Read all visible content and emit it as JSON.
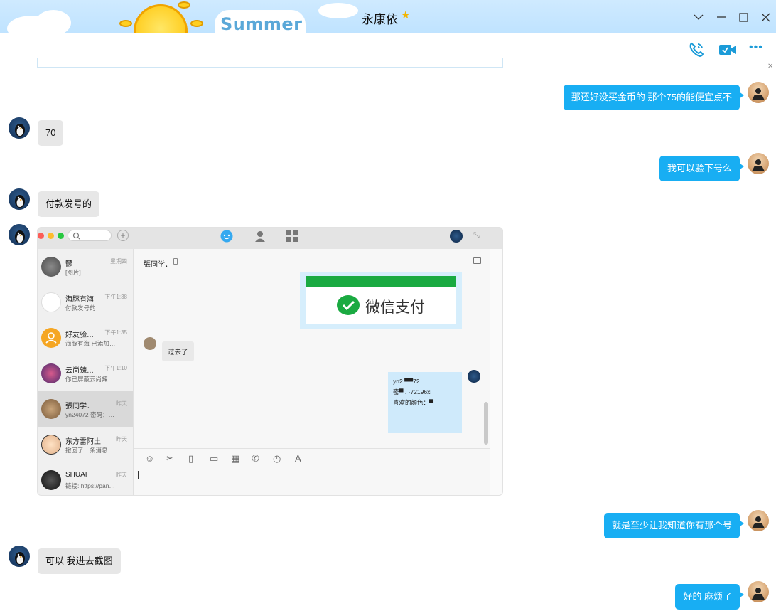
{
  "window": {
    "title": "永康依",
    "skin_text": "Summer",
    "controls": [
      "chevron-down",
      "minimize",
      "maximize",
      "close"
    ]
  },
  "toolbar": {
    "icons": [
      "voice-call-icon",
      "video-call-icon",
      "more-icon"
    ],
    "more_glyph": "•••"
  },
  "messages": [
    {
      "side": "out",
      "text": "那还好没买金币的 那个75的能便宜点不"
    },
    {
      "side": "in",
      "text": "70"
    },
    {
      "side": "out",
      "text": "我可以验下号么"
    },
    {
      "side": "in",
      "text": "付款发号的"
    },
    {
      "side": "in",
      "type": "image"
    },
    {
      "side": "out",
      "text": "就是至少让我知道你有那个号"
    },
    {
      "side": "in",
      "text": "可以 我进去截图"
    },
    {
      "side": "out",
      "text": "好的 麻烦了"
    }
  ],
  "screenshot": {
    "conversations": [
      {
        "name": "鬱",
        "time": "星期四",
        "preview": "[图片]"
      },
      {
        "name": "海豚有海",
        "time": "下午1:38",
        "preview": "付款发号的"
      },
      {
        "name": "好友验…",
        "time": "下午1:35",
        "preview": "海豚有海 已添加…"
      },
      {
        "name": "云尚辣…",
        "time": "下午1:10",
        "preview": "你已屏蔽云尚辣…"
      },
      {
        "name": "張同学．",
        "time": "昨天",
        "preview": "yn24072 密码：…"
      },
      {
        "name": "东方雷阿土",
        "time": "昨天",
        "preview": "撤回了一条消息"
      },
      {
        "name": "SHUAI",
        "time": "昨天",
        "preview": "链接: https://pan…"
      }
    ],
    "chat_name": "張同学．",
    "wechat_pay": "微信支付",
    "reply": "过去了",
    "account_lines": [
      "yn2 ▀▀72",
      "密▀    .   ·72196xi",
      "喜欢的颜色：▀"
    ]
  },
  "colors": {
    "outgoing": "#18aef3",
    "incoming": "#e7e7e7",
    "titlebar": "#bfe3ff",
    "wechat_green": "#1aaa41"
  }
}
